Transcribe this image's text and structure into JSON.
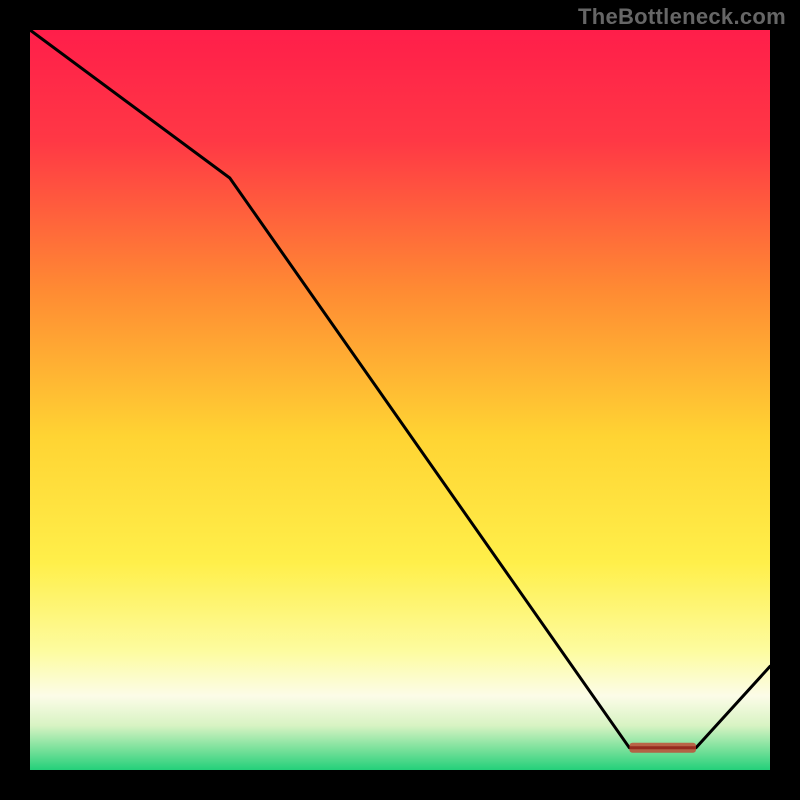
{
  "watermark": "TheBottleneck.com",
  "colors": {
    "frame": "#000000",
    "line": "#000000",
    "watermark": "#666666",
    "gradient_stops": [
      {
        "offset": 0.0,
        "color": "#ff1e4a"
      },
      {
        "offset": 0.15,
        "color": "#ff3845"
      },
      {
        "offset": 0.35,
        "color": "#ff8a33"
      },
      {
        "offset": 0.55,
        "color": "#ffd433"
      },
      {
        "offset": 0.72,
        "color": "#ffef4a"
      },
      {
        "offset": 0.84,
        "color": "#fdfca0"
      },
      {
        "offset": 0.9,
        "color": "#fcfce8"
      },
      {
        "offset": 0.94,
        "color": "#d8f3c3"
      },
      {
        "offset": 0.97,
        "color": "#7fe29d"
      },
      {
        "offset": 1.0,
        "color": "#24d07a"
      }
    ]
  },
  "chart_data": {
    "type": "line",
    "title": "",
    "xlabel": "",
    "ylabel": "",
    "xlim": [
      0,
      100
    ],
    "ylim": [
      0,
      100
    ],
    "series": [
      {
        "name": "curve",
        "x": [
          0,
          27,
          81,
          90,
          100
        ],
        "y": [
          100,
          80,
          3,
          3,
          14
        ]
      }
    ],
    "annotation": {
      "text_blurred": true,
      "x_range": [
        81,
        90
      ],
      "y": 3
    }
  }
}
